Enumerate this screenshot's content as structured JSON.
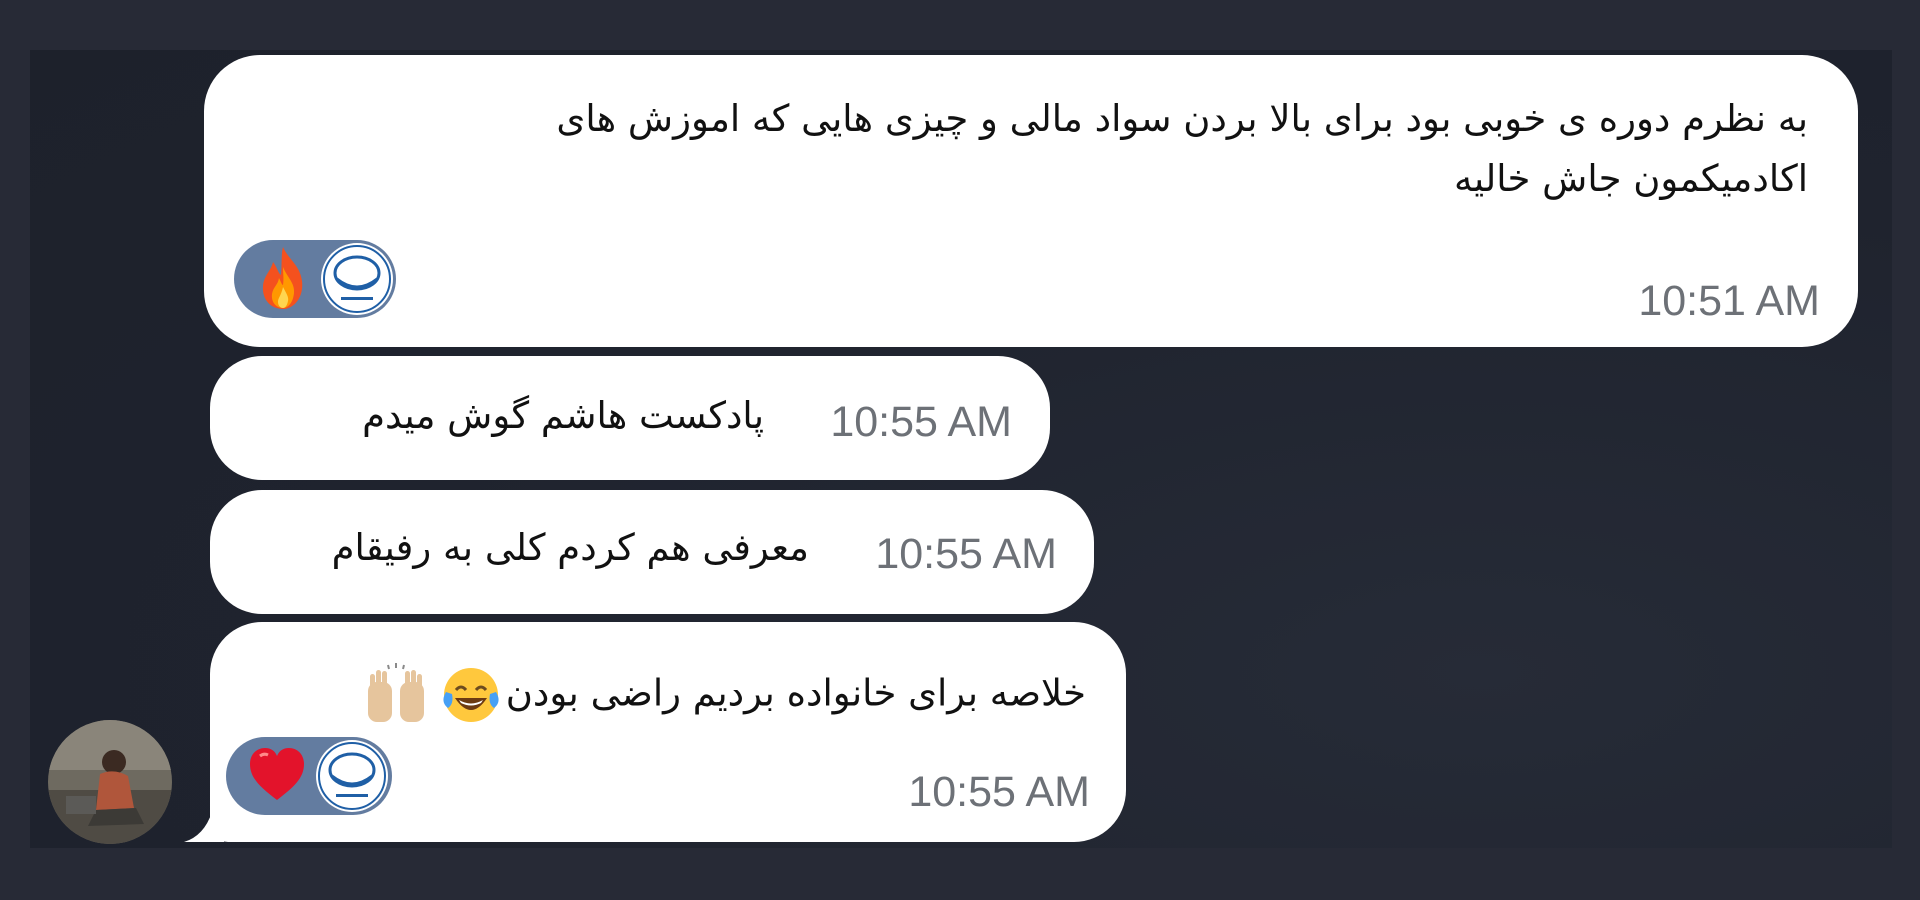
{
  "messages": [
    {
      "text_line1": "به نظرم دوره ی خوبی بود برای بالا بردن سواد مالی و چیزی هایی که اموزش های",
      "text_line2": "اکادمیکمون  جاش خالیه",
      "time": "10:51 AM",
      "reactions": [
        "fire-emoji",
        "channel-avatar"
      ]
    },
    {
      "text": "پادکست هاشم گوش میدم",
      "time": "10:55 AM"
    },
    {
      "text": "معرفی هم کردم کلی به رفیقام",
      "time": "10:55 AM"
    },
    {
      "text": "خلاصه برای خانواده بردیم راضی بودن",
      "emojis": [
        "face-with-tears-of-joy",
        "raising-hands"
      ],
      "time": "10:55 AM",
      "reactions": [
        "heart-emoji",
        "channel-avatar"
      ]
    }
  ],
  "colors": {
    "background": "#272a36",
    "bubble": "#ffffff",
    "reaction_pill": "#637ca0",
    "time_text": "#6d7177"
  }
}
